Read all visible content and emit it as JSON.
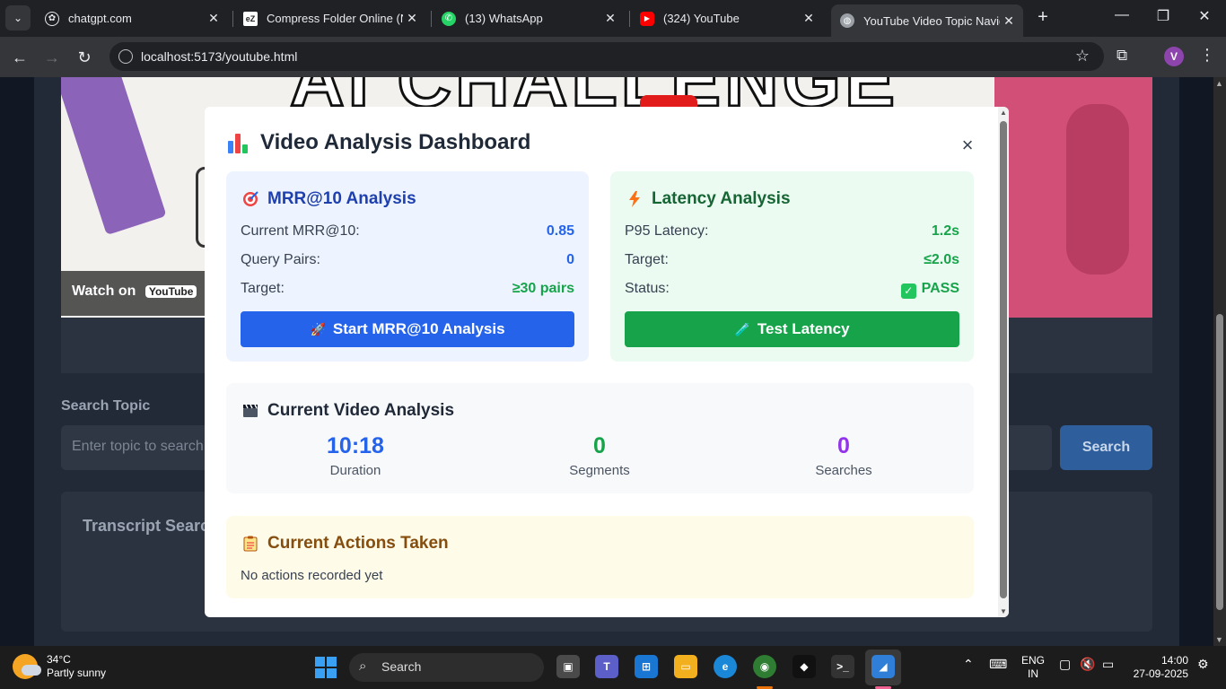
{
  "browser": {
    "tabs": [
      {
        "title": "chatgpt.com",
        "icon": "chatgpt-icon"
      },
      {
        "title": "Compress Folder Online (No",
        "icon": "ezyzip-icon"
      },
      {
        "title": "(13) WhatsApp",
        "icon": "whatsapp-icon"
      },
      {
        "title": "(324) YouTube",
        "icon": "youtube-icon"
      },
      {
        "title": "YouTube Video Topic Naviga",
        "icon": "globe-icon"
      }
    ],
    "url": "localhost:5173/youtube.html",
    "profile_initial": "V"
  },
  "page": {
    "video_overlay": {
      "watch_on": "Watch on",
      "yt_label": "YouTube"
    },
    "video_banner": "AI CHALLENGE",
    "search_label": "Search Topic",
    "search_placeholder": "Enter topic to search",
    "search_button": "Search",
    "transcript_title": "Transcript Search"
  },
  "modal": {
    "title": "Video Analysis Dashboard",
    "close": "×",
    "mrr": {
      "title": "MRR@10 Analysis",
      "rows": [
        {
          "label": "Current MRR@10:",
          "value": "0.85"
        },
        {
          "label": "Query Pairs:",
          "value": "0"
        },
        {
          "label": "Target:",
          "value": "≥30 pairs"
        }
      ],
      "button": "Start MRR@10 Analysis"
    },
    "latency": {
      "title": "Latency Analysis",
      "rows": [
        {
          "label": "P95 Latency:",
          "value": "1.2s"
        },
        {
          "label": "Target:",
          "value": "≤2.0s"
        },
        {
          "label": "Status:",
          "value": "PASS"
        }
      ],
      "button": "Test Latency"
    },
    "current_video": {
      "title": "Current Video Analysis",
      "metrics": [
        {
          "value": "10:18",
          "label": "Duration",
          "color": "#2563eb"
        },
        {
          "value": "0",
          "label": "Segments",
          "color": "#16a34a"
        },
        {
          "value": "0",
          "label": "Searches",
          "color": "#9333ea"
        }
      ]
    },
    "actions": {
      "title": "Current Actions Taken",
      "empty_text": "No actions recorded yet"
    }
  },
  "taskbar": {
    "weather_temp": "34°C",
    "weather_desc": "Partly sunny",
    "search_label": "Search",
    "lang_line1": "ENG",
    "lang_line2": "IN",
    "time": "14:00",
    "date": "27-09-2025"
  },
  "colors": {
    "accent_blue": "#2563eb",
    "accent_green": "#16a34a",
    "accent_purple": "#9333ea"
  }
}
